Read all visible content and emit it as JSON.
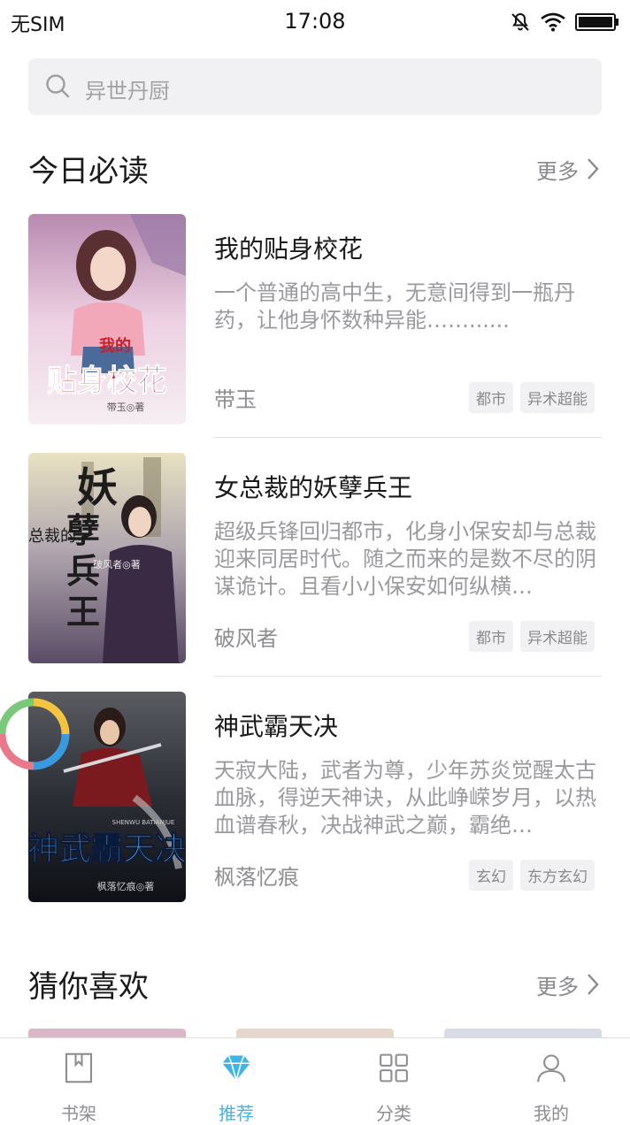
{
  "status_bar": {
    "carrier": "无SIM",
    "time": "17:08",
    "icons": [
      "mute-icon",
      "wifi-icon",
      "battery-icon"
    ]
  },
  "search": {
    "placeholder": "异世丹厨",
    "icon": "search-icon"
  },
  "today_section": {
    "title": "今日必读",
    "more_label": "更多",
    "books": [
      {
        "title": "我的贴身校花",
        "description": "一个普通的高中生，无意间得到一瓶丹药，让他身怀数种异能……......",
        "author": "带玉",
        "tags": [
          "都市",
          "异术超能"
        ],
        "cover": {
          "title_text": "贴身校花",
          "small_text": "我的",
          "author_text": "带玉◎著",
          "palette": [
            "#e9c9dc",
            "#c68ab6",
            "#7a4a7a"
          ],
          "title_color": "#c81f2a"
        }
      },
      {
        "title": "女总裁的妖孽兵王",
        "description": "超级兵锋回归都市，化身小保安却与总裁迎来同居时代。随之而来的是数不尽的阴谋诡计。且看小小保安如何纵横…",
        "author": "破风者",
        "tags": [
          "都市",
          "异术超能"
        ],
        "cover": {
          "title_text": "妖孽兵王",
          "small_text": "女总裁的",
          "author_text": "破风者◎著",
          "palette": [
            "#d9d3b5",
            "#7a6c86",
            "#3a2d3e"
          ],
          "title_color": "#1c1c1c"
        }
      },
      {
        "title": "神武霸天决",
        "description": "天寂大陆，武者为尊，少年苏炎觉醒太古血脉，得逆天神诀，从此峥嵘岁月，以热血谱春秋，决战神武之巅，霸绝…",
        "author": "枫落忆痕",
        "tags": [
          "玄幻",
          "东方玄幻"
        ],
        "cover": {
          "title_text": "神武霸天决",
          "small_text": "SHENWU BATIANJUE",
          "author_text": "枫落忆痕◎著",
          "palette": [
            "#4a4c52",
            "#262830",
            "#101218"
          ],
          "title_color": "#5ab0f0"
        }
      }
    ]
  },
  "guess_section": {
    "title": "猜你喜欢",
    "more_label": "更多"
  },
  "tab_bar": {
    "tabs": [
      {
        "label": "书架",
        "icon": "bookshelf-icon",
        "active": false
      },
      {
        "label": "推荐",
        "icon": "diamond-icon",
        "active": true
      },
      {
        "label": "分类",
        "icon": "category-grid-icon",
        "active": false
      },
      {
        "label": "我的",
        "icon": "profile-icon",
        "active": false
      }
    ]
  },
  "colors": {
    "accent": "#3fb4e8",
    "text_primary": "#1a1a1a",
    "text_secondary": "#9a9a9e",
    "tag_bg": "#f1f1f3"
  }
}
